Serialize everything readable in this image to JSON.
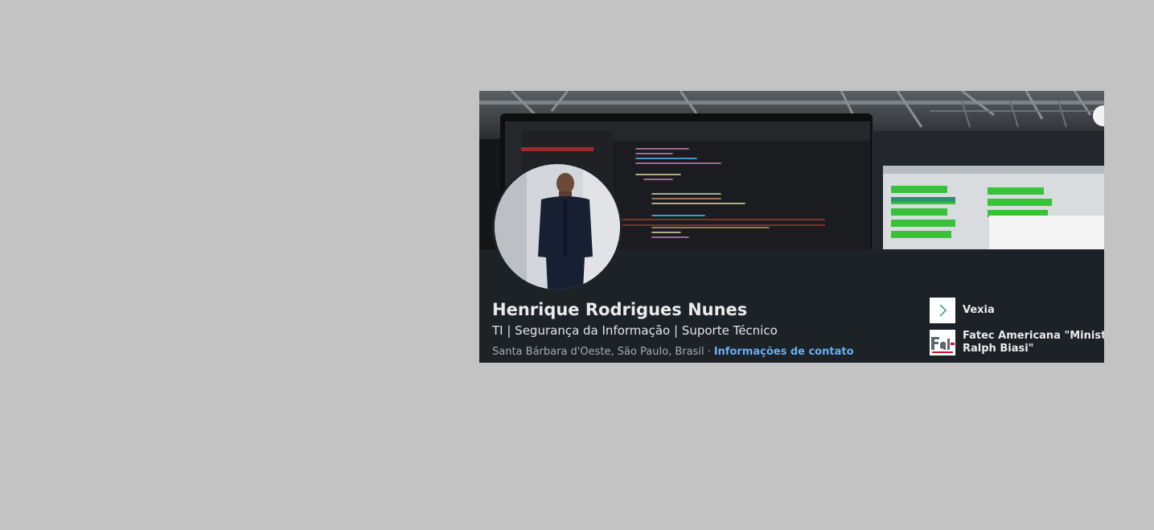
{
  "profile": {
    "name": "Henrique Rodrigues Nunes",
    "headline": "TI | Segurança da Informação | Suporte Técnico",
    "location": "Santa Bárbara d'Oeste, São Paulo, Brasil",
    "separator": "·",
    "contact_link": "Informações de contato"
  },
  "organizations": [
    {
      "name": "Vexia",
      "logo_icon": "chevron-right-icon"
    },
    {
      "name_line1": "Fatec Americana \"Ministro",
      "name_line2": "Ralph Biasi\"",
      "logo_icon": "fatec-logo"
    }
  ],
  "colors": {
    "page_background": "#c3c3c3",
    "card_background": "#1d2226",
    "link": "#6aaef0",
    "vexia_chevron": "#46a7a3",
    "fatec_red": "#c8102e"
  }
}
